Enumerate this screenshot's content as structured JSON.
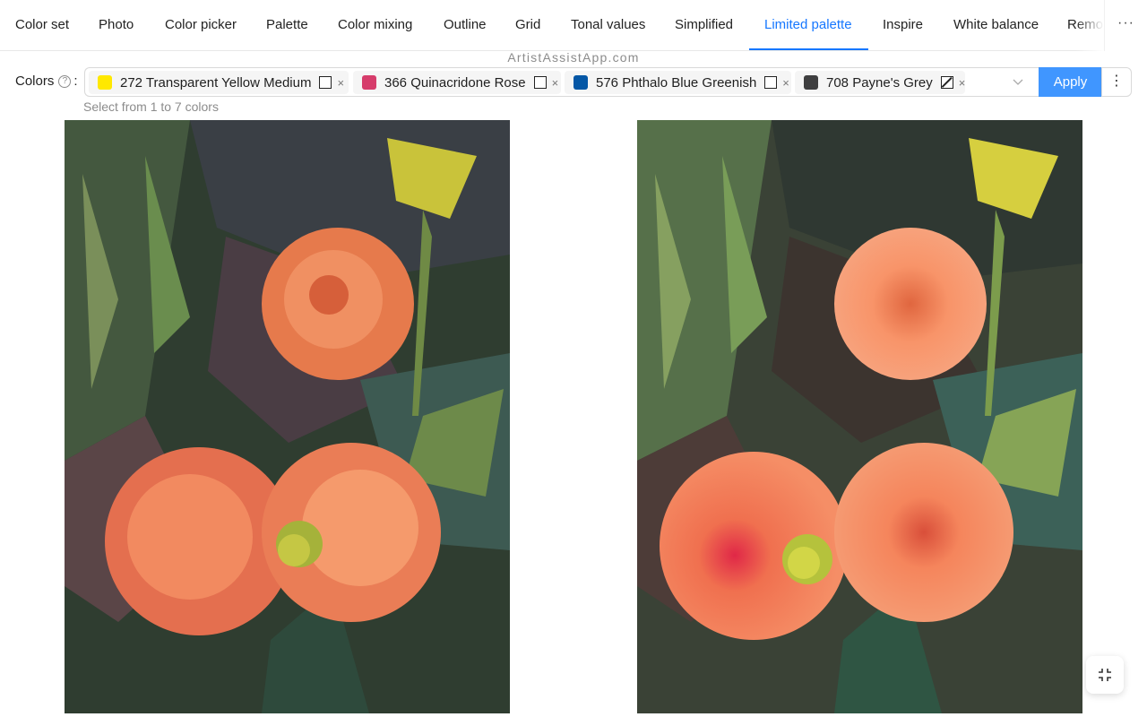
{
  "tabs": [
    {
      "label": "Color set"
    },
    {
      "label": "Photo"
    },
    {
      "label": "Color picker"
    },
    {
      "label": "Palette"
    },
    {
      "label": "Color mixing"
    },
    {
      "label": "Outline"
    },
    {
      "label": "Grid"
    },
    {
      "label": "Tonal values"
    },
    {
      "label": "Simplified"
    },
    {
      "label": "Limited palette"
    },
    {
      "label": "Inspire"
    },
    {
      "label": "White balance"
    },
    {
      "label": "Remo"
    }
  ],
  "active_tab": "Limited palette",
  "more_tabs_label": "···",
  "watermark": "ArtistAssistApp.com",
  "colors": {
    "label": "Colors",
    "help_icon": "?",
    "colon": ":",
    "selected": [
      {
        "name": "272 Transparent Yellow Medium",
        "color": "#ffe800",
        "checked": false
      },
      {
        "name": "366 Quinacridone Rose",
        "color": "#d63c6b",
        "checked": false
      },
      {
        "name": "576 Phthalo Blue Greenish",
        "color": "#0457a6",
        "checked": false
      },
      {
        "name": "708 Payne's Grey",
        "color": "#3f3f40",
        "checked": false,
        "slashed": true
      }
    ],
    "remove_glyph": "×",
    "hint": "Select from 1 to 7 colors"
  },
  "apply_label": "Apply",
  "menu_glyph": "⋮",
  "accent_color": "#1677ff",
  "images": {
    "left": "limited-palette-result",
    "right": "original-photo"
  },
  "collapse_icon": "collapse-icon"
}
